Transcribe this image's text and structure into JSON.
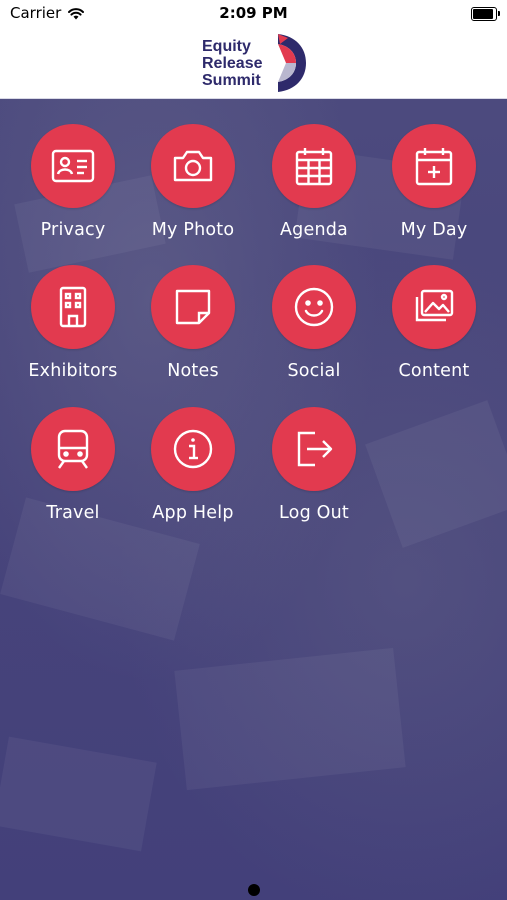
{
  "status_bar": {
    "carrier": "Carrier",
    "time": "2:09 PM",
    "battery_level": 0.9
  },
  "header": {
    "logo_lines": [
      "Equity",
      "Release",
      "Summit"
    ],
    "colors": {
      "brand_navy": "#2e2a6b",
      "brand_red": "#e23a4f"
    }
  },
  "menu": {
    "items": [
      {
        "label": "Privacy",
        "icon": "id-card-icon"
      },
      {
        "label": "My Photo",
        "icon": "camera-icon"
      },
      {
        "label": "Agenda",
        "icon": "calendar-grid-icon"
      },
      {
        "label": "My Day",
        "icon": "calendar-plus-icon"
      },
      {
        "label": "Exhibitors",
        "icon": "building-icon"
      },
      {
        "label": "Notes",
        "icon": "sticky-note-icon"
      },
      {
        "label": "Social",
        "icon": "smiley-icon"
      },
      {
        "label": "Content",
        "icon": "images-icon"
      },
      {
        "label": "Travel",
        "icon": "train-icon"
      },
      {
        "label": "App Help",
        "icon": "info-icon"
      },
      {
        "label": "Log Out",
        "icon": "logout-icon"
      }
    ]
  },
  "pager": {
    "current_page": 1,
    "page_count": 1
  }
}
